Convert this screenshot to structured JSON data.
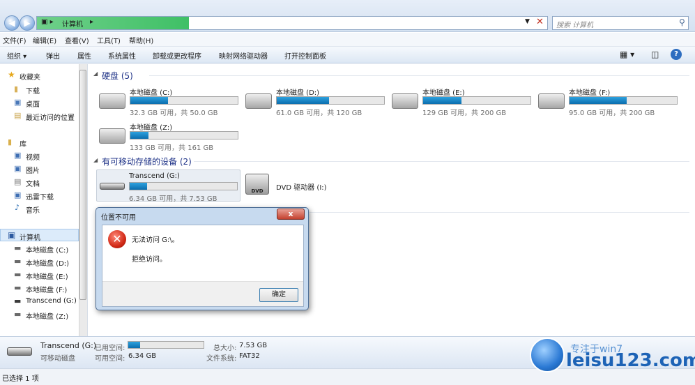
{
  "address": {
    "path_label": "计算机",
    "search_placeholder": "搜索 计算机"
  },
  "menu": [
    "文件(F)",
    "编辑(E)",
    "查看(V)",
    "工具(T)",
    "帮助(H)"
  ],
  "toolbar": {
    "organize": "组织",
    "items": [
      "弹出",
      "属性",
      "系统属性",
      "卸载或更改程序",
      "映射网络驱动器",
      "打开控制面板"
    ]
  },
  "sidebar": {
    "favorites": {
      "title": "收藏夹",
      "items": [
        "下载",
        "桌面",
        "最近访问的位置"
      ]
    },
    "libraries": {
      "title": "库",
      "items": [
        "视频",
        "图片",
        "文档",
        "迅雷下载",
        "音乐"
      ]
    },
    "computer": {
      "title": "计算机",
      "items": [
        "本地磁盘 (C:)",
        "本地磁盘 (D:)",
        "本地磁盘 (E:)",
        "本地磁盘 (F:)",
        "Transcend (G:)",
        "本地磁盘 (Z:)"
      ]
    }
  },
  "groups": {
    "hdd": "硬盘 (5)",
    "removable": "有可移动存储的设备 (2)"
  },
  "drives": [
    {
      "name": "本地磁盘 (C:)",
      "size": "32.3 GB 可用，共 50.0 GB",
      "used": 0.35
    },
    {
      "name": "本地磁盘 (D:)",
      "size": "61.0 GB 可用，共 120 GB",
      "used": 0.49
    },
    {
      "name": "本地磁盘 (E:)",
      "size": "129 GB 可用，共 200 GB",
      "used": 0.36
    },
    {
      "name": "本地磁盘 (F:)",
      "size": "95.0 GB 可用，共 200 GB",
      "used": 0.53
    },
    {
      "name": "本地磁盘 (Z:)",
      "size": "133 GB 可用，共 161 GB",
      "used": 0.17
    },
    {
      "name": "Transcend (G:)",
      "size": "6.34 GB 可用，共 7.53 GB",
      "used": 0.16
    },
    {
      "name": "DVD 驱动器 (I:)"
    }
  ],
  "dialog": {
    "title": "位置不可用",
    "close": "x",
    "line1": "无法访问 G:\\。",
    "line2": "拒绝访问。",
    "ok": "确定"
  },
  "details": {
    "name": "Transcend (G:)",
    "type": "可移动磁盘",
    "used_label": "已用空间:",
    "free_label": "可用空间:",
    "free_value": "6.34 GB",
    "total_label": "总大小:",
    "total_value": "7.53 GB",
    "fs_label": "文件系统:",
    "fs_value": "FAT32",
    "used_fraction": 0.16
  },
  "status": "已选择 1 项",
  "watermark": "leisu123.com",
  "watermark_top": "专注于win7"
}
